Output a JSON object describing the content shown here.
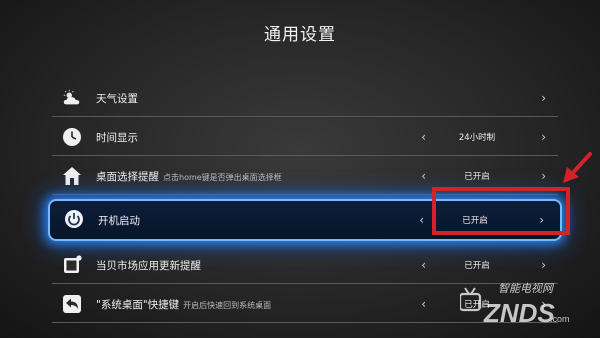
{
  "page": {
    "title": "通用设置"
  },
  "rows": [
    {
      "label": "天气设置",
      "hint": "",
      "value": "",
      "icon": "weather-icon"
    },
    {
      "label": "时间显示",
      "hint": "",
      "value": "24小时制",
      "icon": "clock-icon"
    },
    {
      "label": "桌面选择提醒",
      "hint": "点击home键是否弹出桌面选择框",
      "value": "已开启",
      "icon": "home-icon"
    },
    {
      "label": "开机启动",
      "hint": "",
      "value": "已开启",
      "icon": "power-icon"
    },
    {
      "label": "当贝市场应用更新提醒",
      "hint": "",
      "value": "已开启",
      "icon": "update-icon"
    },
    {
      "label": "\"系统桌面\"快捷键",
      "hint": "开启后快速回到系统桌面",
      "value": "已开启",
      "icon": "return-icon"
    }
  ],
  "arrows": {
    "left": "‹",
    "right": "›"
  },
  "watermark": {
    "top": "智能电视网",
    "bottom": "ZNDS.com"
  },
  "colors": {
    "focus_glow": "#2a8cff",
    "highlight_box": "#d3222a"
  }
}
